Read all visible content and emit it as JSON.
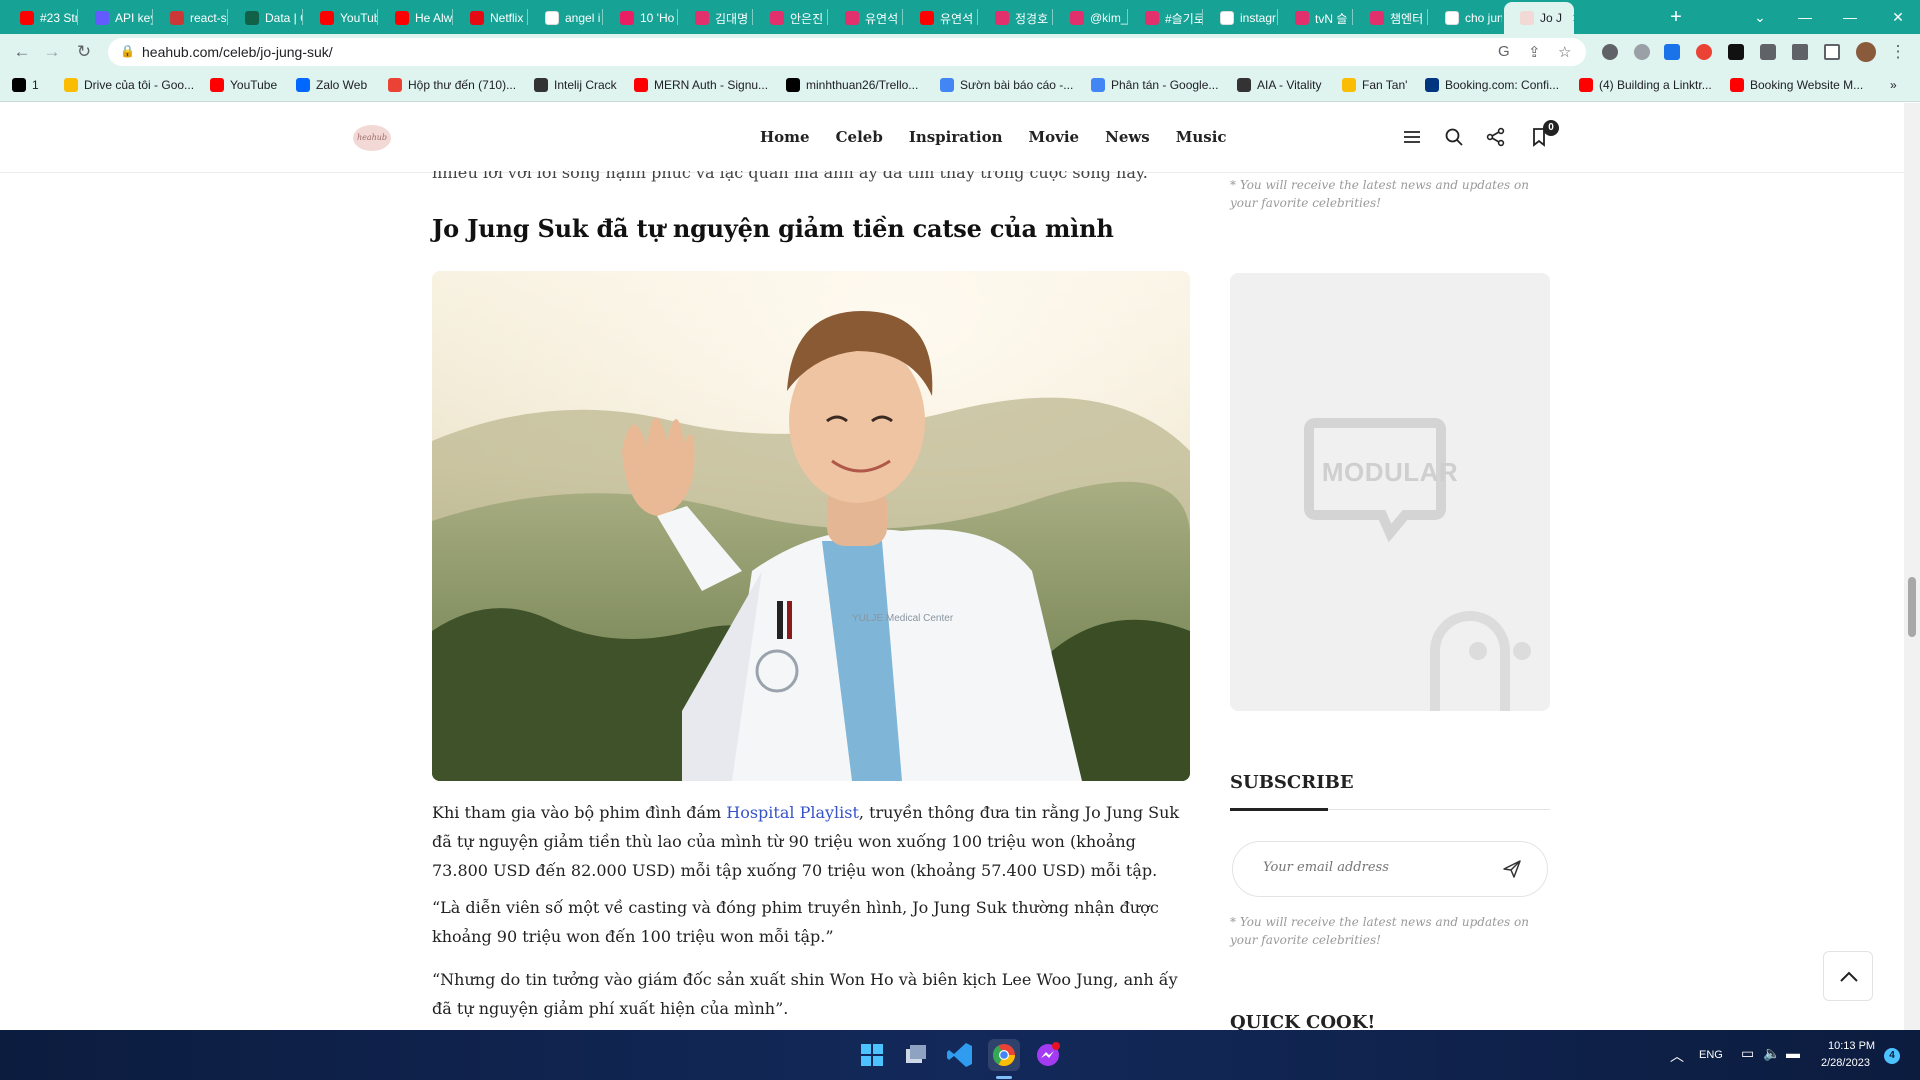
{
  "browser": {
    "tabs": [
      {
        "title": "#23 Str",
        "icon": "youtube-icon",
        "color": "#ff0000"
      },
      {
        "title": "API key",
        "icon": "s-icon",
        "color": "#635bff"
      },
      {
        "title": "react-s",
        "icon": "n-icon",
        "color": "#cb3837"
      },
      {
        "title": "Data | C",
        "icon": "mongodb-icon",
        "color": "#116149"
      },
      {
        "title": "YouTub",
        "icon": "youtube-icon",
        "color": "#ff0000"
      },
      {
        "title": "He Alw",
        "icon": "youtube-icon",
        "color": "#ff0000"
      },
      {
        "title": "Netflix",
        "icon": "netflix-icon",
        "color": "#e50914"
      },
      {
        "title": "angel i",
        "icon": "google-icon",
        "color": "#ffffff"
      },
      {
        "title": "10 'Ho",
        "icon": "c-icon",
        "color": "#e91e63"
      },
      {
        "title": "김대명",
        "icon": "instagram-icon",
        "color": "#e1306c"
      },
      {
        "title": "안은진",
        "icon": "instagram-icon",
        "color": "#e1306c"
      },
      {
        "title": "유연석",
        "icon": "instagram-icon",
        "color": "#e1306c"
      },
      {
        "title": "유연석",
        "icon": "youtube-icon",
        "color": "#ff0000"
      },
      {
        "title": "정경호",
        "icon": "instagram-icon",
        "color": "#e1306c"
      },
      {
        "title": "@kim_",
        "icon": "instagram-icon",
        "color": "#e1306c"
      },
      {
        "title": "#슬기로",
        "icon": "instagram-icon",
        "color": "#e1306c"
      },
      {
        "title": "instagr",
        "icon": "google-icon",
        "color": "#ffffff"
      },
      {
        "title": "tvN 슬",
        "icon": "instagram-icon",
        "color": "#e1306c"
      },
      {
        "title": "챔엔터",
        "icon": "instagram-icon",
        "color": "#e1306c"
      },
      {
        "title": "cho jun",
        "icon": "google-icon",
        "color": "#ffffff"
      },
      {
        "title": "Jo J",
        "icon": "heahub-icon",
        "color": "#f3d9d6",
        "active": true
      }
    ],
    "new_tab": "+",
    "url": "heahub.com/celeb/jo-jung-suk/",
    "bookmarks": [
      {
        "label": "1",
        "icon": "tiktok-icon",
        "color": "#000000"
      },
      {
        "label": "Drive của tôi - Goo...",
        "icon": "drive-icon",
        "color": "#fbbc04"
      },
      {
        "label": "YouTube",
        "icon": "youtube-icon",
        "color": "#ff0000"
      },
      {
        "label": "Zalo Web",
        "icon": "zalo-icon",
        "color": "#0068ff"
      },
      {
        "label": "Hộp thư đến (710)...",
        "icon": "gmail-icon",
        "color": "#ea4335"
      },
      {
        "label": "Intelij Crack",
        "icon": "k-icon",
        "color": "#333333"
      },
      {
        "label": "MERN Auth - Signu...",
        "icon": "youtube-icon",
        "color": "#ff0000"
      },
      {
        "label": "minhthuan26/Trello...",
        "icon": "github-icon",
        "color": "#000000"
      },
      {
        "label": "Sườn bài báo cáo -...",
        "icon": "docs-icon",
        "color": "#4285f4"
      },
      {
        "label": "Phân tán - Google...",
        "icon": "docs-icon",
        "color": "#4285f4"
      },
      {
        "label": "AIA - Vitality",
        "icon": "aia-icon",
        "color": "#333333"
      },
      {
        "label": "Fan Tan'",
        "icon": "drive-icon",
        "color": "#fbbc04"
      },
      {
        "label": "Booking.com: Confi...",
        "icon": "booking-icon",
        "color": "#003580"
      },
      {
        "label": "(4) Building a Linktr...",
        "icon": "youtube-icon",
        "color": "#ff0000"
      },
      {
        "label": "Booking Website M...",
        "icon": "youtube-icon",
        "color": "#ff0000"
      }
    ],
    "bookmarks_more": "»"
  },
  "site": {
    "logo_text": "heahub",
    "nav": [
      "Home",
      "Celeb",
      "Inspiration",
      "Movie",
      "News",
      "Music"
    ],
    "bookmark_count": "0"
  },
  "article": {
    "faded_line": "nhiều lời với lối sống hạnh phúc và lạc quan mà anh ấy đã tìm thấy trong cuộc sống này.",
    "heading": "Jo Jung Suk đã tự nguyện giảm tiền catse của mình",
    "photo_alt": "YULJE Medical Center",
    "paragraph1_before": "Khi tham gia vào bộ phim đình đám ",
    "paragraph1_link": "Hospital Playlist",
    "paragraph1_after": ", truyền thông đưa tin rằng Jo Jung Suk đã tự nguyện giảm tiền thù lao của mình từ 90 triệu won xuống 100 triệu won (khoảng 73.800 USD đến 82.000 USD) mỗi tập xuống 70 triệu won (khoảng 57.400 USD) mỗi tập.",
    "paragraph2": "“Là diễn viên số một về casting và đóng phim truyền hình, Jo Jung Suk thường nhận được khoảng 90 triệu won đến 100 triệu won mỗi tập.”",
    "paragraph3": "“Nhưng do tin tưởng vào giám đốc sản xuất shin Won Ho và biên kịch Lee Woo Jung, anh ấy đã tự nguyện giảm phí xuất hiện của mình”."
  },
  "sidebar": {
    "top_note": "* You will receive the latest news and updates on your favorite celebrities!",
    "ad_label": "MODULAR",
    "subscribe_heading": "SUBSCRIBE",
    "email_placeholder": "Your email address",
    "sub_note": "* You will receive the latest news and updates on your favorite celebrities!",
    "quick_heading": "QUICK COOK!"
  },
  "taskbar": {
    "language": "ENG",
    "time": "10:13 PM",
    "date": "2/28/2023",
    "notifications": "4"
  },
  "colors": {
    "chrome_accent": "#16a396",
    "chrome_toolbar": "#dff3ef",
    "link": "#3553c9"
  }
}
